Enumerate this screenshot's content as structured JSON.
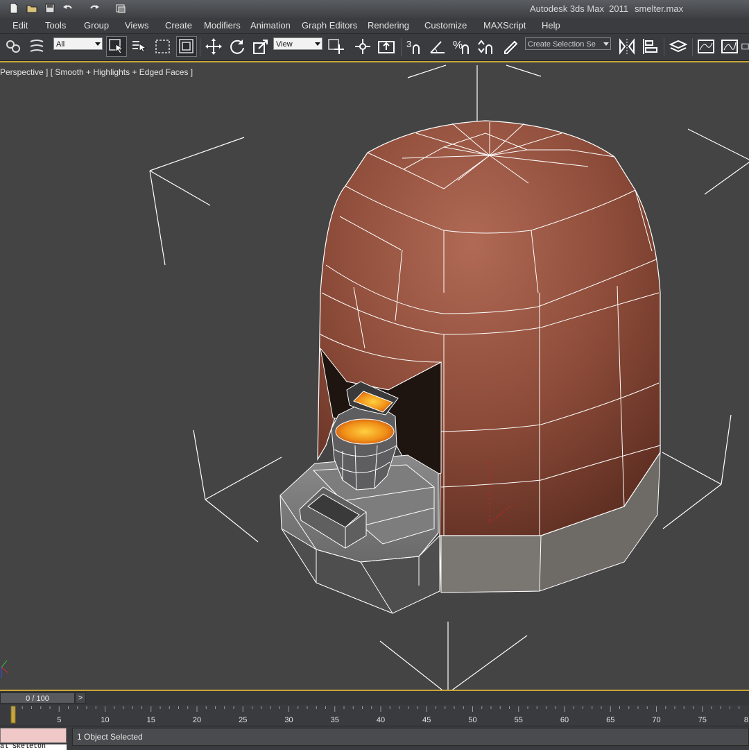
{
  "titlebar": {
    "app_title": "Autodesk 3ds Max  2011",
    "file_name": "smelter.max",
    "quick_access": [
      "new-file-icon",
      "open-file-icon",
      "save-icon",
      "undo-icon",
      "redo-icon",
      "project-folder-icon"
    ]
  },
  "menu": {
    "items": [
      "Edit",
      "Tools",
      "Group",
      "Views",
      "Create",
      "Modifiers",
      "Animation",
      "Graph Editors",
      "Rendering",
      "Customize",
      "MAXScript",
      "Help"
    ]
  },
  "toolbar": {
    "selection_filter": "All",
    "reference_coord": "View",
    "named_selection_placeholder": "Create Selection Se",
    "snap_label": "3",
    "angle_snap_label": "%"
  },
  "viewport": {
    "label": "Perspective ] [ Smooth + Highlights + Edged Faces ]",
    "object": "smelter"
  },
  "timeline": {
    "frame_counter": "0 / 100",
    "next_label": ">",
    "ticks": [
      "5",
      "10",
      "15",
      "20",
      "25",
      "30",
      "35",
      "40",
      "45",
      "50",
      "55",
      "60",
      "65",
      "70",
      "75",
      "8"
    ]
  },
  "status": {
    "selection_text": "1 Object Selected",
    "listener_text": "al Skeleton"
  },
  "colors": {
    "viewport_bg": "#444444",
    "active_border": "#c8a73a",
    "wire": "#ffffff",
    "brick": "#8a4a36",
    "stone": "#6f6f6f",
    "molten": "#f0a020"
  }
}
